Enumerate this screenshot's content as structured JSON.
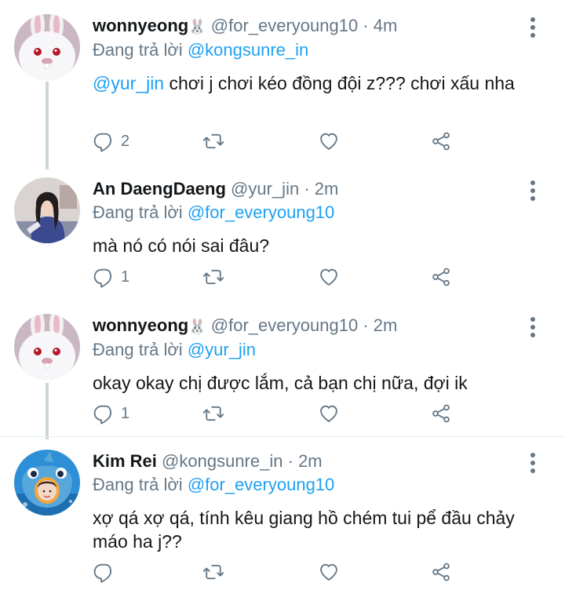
{
  "tweets": [
    {
      "name": "wonnyeong",
      "name_suffix": "🐰",
      "handle": "@for_everyoung10",
      "time": "4m",
      "reply_prefix": "Đang trả lời",
      "reply_to": "@kongsunre_in",
      "mention": "@yur_jin",
      "text": " chơi j chơi kéo đồng đội z??? chơi xấu nha",
      "replies": "2",
      "avatar": "white-rabbit-avatar"
    },
    {
      "name": "An DaengDaeng",
      "handle": "@yur_jin",
      "time": "2m",
      "reply_prefix": "Đang trả lời",
      "reply_to": "@for_everyoung10",
      "text": "mà nó có nói sai đâu?",
      "replies": "1",
      "avatar": "girl-photo-avatar"
    },
    {
      "name": "wonnyeong",
      "name_suffix": "🐰",
      "handle": "@for_everyoung10",
      "time": "2m",
      "reply_prefix": "Đang trả lời",
      "reply_to": "@yur_jin",
      "text": "okay okay chị được lắm, cả bạn chị nữa, đợi ik",
      "replies": "1",
      "avatar": "white-rabbit-avatar"
    },
    {
      "name": "Kim Rei",
      "handle": "@kongsunre_in",
      "time": "2m",
      "reply_prefix": "Đang trả lời",
      "reply_to": "@for_everyoung10",
      "text": "xợ qá xợ qá, tính kêu giang hồ chém tui pể đầu chảy máo ha j??",
      "replies": "",
      "avatar": "baby-shark-avatar"
    }
  ],
  "separator": "·",
  "colors": {
    "accent": "#1da1f2",
    "muted": "#657786",
    "line": "#ccd6dd"
  },
  "icons": [
    "reply-icon",
    "retweet-icon",
    "like-icon",
    "share-icon",
    "more-icon"
  ]
}
